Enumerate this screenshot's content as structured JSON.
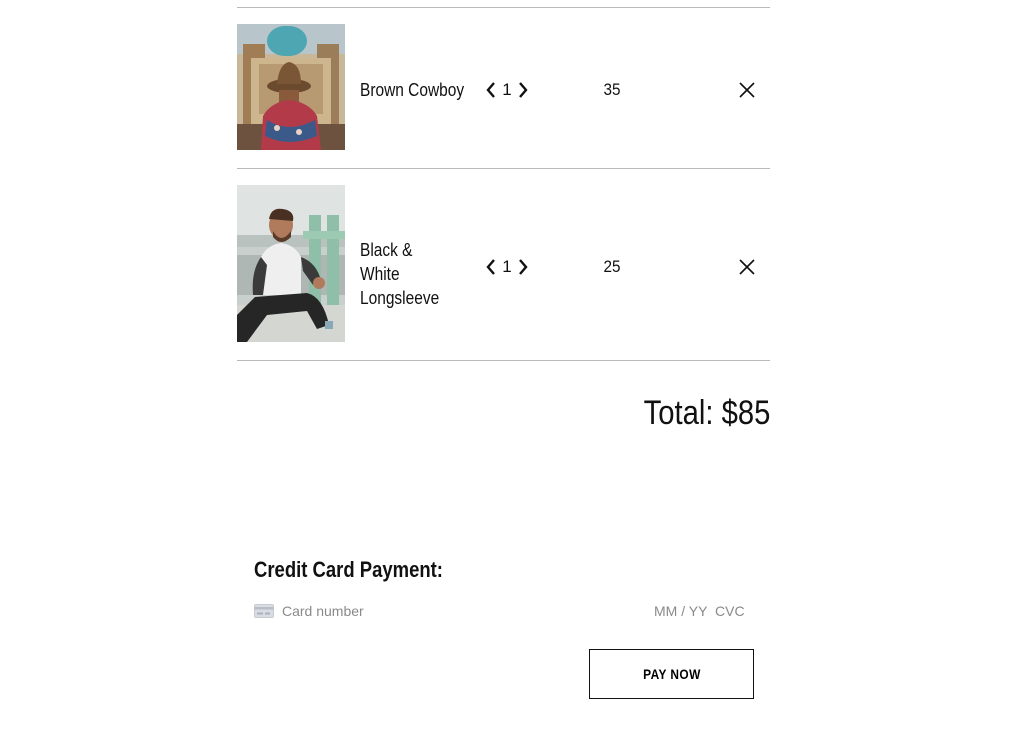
{
  "cart": {
    "items": [
      {
        "name": "Brown Cowboy",
        "quantity": "1",
        "price": "35",
        "image": "man-in-cowboy-hat-photo"
      },
      {
        "name": "Black & White Longsleeve",
        "quantity": "1",
        "price": "25",
        "image": "man-in-raglan-longsleeve-photo"
      }
    ],
    "total": "Total: $85"
  },
  "payment": {
    "title": "Credit Card Payment:",
    "card_placeholder": "Card number",
    "expiry_placeholder": "MM / YY",
    "cvc_placeholder": "CVC",
    "pay_label": "PAY NOW"
  },
  "icons": {
    "decrement": "chevron-left-icon",
    "increment": "chevron-right-icon",
    "remove": "close-icon",
    "card": "credit-card-icon"
  }
}
